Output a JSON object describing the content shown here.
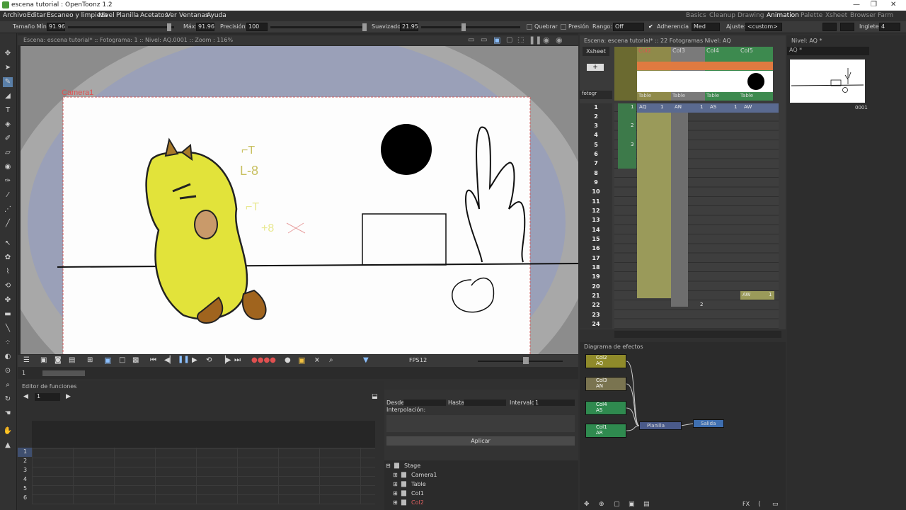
{
  "window": {
    "title": "escena tutorial : OpenToonz 1.2"
  },
  "menu": [
    "Archivo",
    "Editar",
    "Escaneo y limpieza",
    "Nivel",
    "Planilla",
    "Acetatos",
    "Ver",
    "Ventanas",
    "Ayuda"
  ],
  "rooms": [
    "Basics",
    "Cleanup",
    "Drawing",
    "Animation",
    "Palette",
    "Xsheet",
    "Browser",
    "Farm"
  ],
  "active_room": "Animation",
  "tool_options": {
    "size_min_label": "Tamaño Mín:",
    "size_min": "91.96",
    "max_label": "Máx:",
    "max": "91.96",
    "precision_label": "Precisión:",
    "precision": "100",
    "smooth_label": "Suavizado:",
    "smooth": "21.95",
    "break_label": "Quebrar",
    "pressure_label": "Presión",
    "range_label": "Rango:",
    "range": "Off",
    "snap_label": "Adherencia",
    "snap": "Med",
    "fit_label": "Ajuste:",
    "fit": "<custom>",
    "miter_label": "Inglete:",
    "miter": "4"
  },
  "viewer": {
    "header": "Escena: escena tutorial*  ::  Fotograma: 1  ::  Nivel: AQ.0001  ::  Zoom : 116%",
    "camera_label": "Camera1",
    "fps_label": "FPS",
    "fps": "12",
    "frame": "1"
  },
  "function_editor": {
    "title": "Editor de funciones",
    "frame_value": "1",
    "rows": [
      "1",
      "2",
      "3",
      "4",
      "5",
      "6"
    ],
    "from_label": "Desde",
    "to_label": "Hasta",
    "interval_label": "Intervalo",
    "interval": "1",
    "interp_label": "Interpolación:",
    "apply_label": "Aplicar",
    "tree": [
      "Stage",
      "Camera1",
      "Table",
      "Col1",
      "Col2"
    ]
  },
  "xsheet": {
    "header": "Escena: escena tutorial*  ::  22 Fotogramas  Nivel: AQ",
    "tab": "Xsheet",
    "columns": [
      {
        "name": "Col2",
        "bottom": "Table",
        "color": "#8f8a4a"
      },
      {
        "name": "Col3",
        "bottom": "Table",
        "color": "#7a7a7a"
      },
      {
        "name": "Col4",
        "bottom": "Table",
        "color": "#3d8a4f"
      },
      {
        "name": "Col5",
        "bottom": "Table",
        "color": "#3d8a4f"
      }
    ],
    "cells_row1": [
      "1",
      "AQ",
      "1",
      "AN",
      "1",
      "AS",
      "1",
      "AW"
    ],
    "rows": [
      "1",
      "2",
      "3",
      "4",
      "5",
      "6",
      "7",
      "8",
      "9",
      "10",
      "11",
      "12",
      "13",
      "14",
      "15",
      "16",
      "17",
      "18",
      "19",
      "20",
      "21",
      "22",
      "23",
      "24"
    ],
    "left_cells": [
      "1",
      "2",
      "3"
    ],
    "row21_cell": "AW",
    "row21_num": "1",
    "row22_num": "2",
    "fotogr_label": "fotogr"
  },
  "level_strip": {
    "title": "Nivel: AQ *",
    "level": "AQ *",
    "frame": "0001"
  },
  "fx_schematic": {
    "title": "Diagrama de efectos",
    "nodes": [
      {
        "col": "Col2",
        "lvl": "AQ",
        "color": "#8f8a2a"
      },
      {
        "col": "Col3",
        "lvl": "AN",
        "color": "#7a7450"
      },
      {
        "col": "Col4",
        "lvl": "AS",
        "color": "#2f8a4f"
      },
      {
        "col": "Col1",
        "lvl": "AR",
        "color": "#2f8a4f"
      }
    ],
    "xsheet_node": "Planilla",
    "output_node": "Salida",
    "fx_label": "FX"
  },
  "drawing_text": {
    "a": "⌐T",
    "b": "L-8",
    "c": "⌐T",
    "d": "+8"
  }
}
